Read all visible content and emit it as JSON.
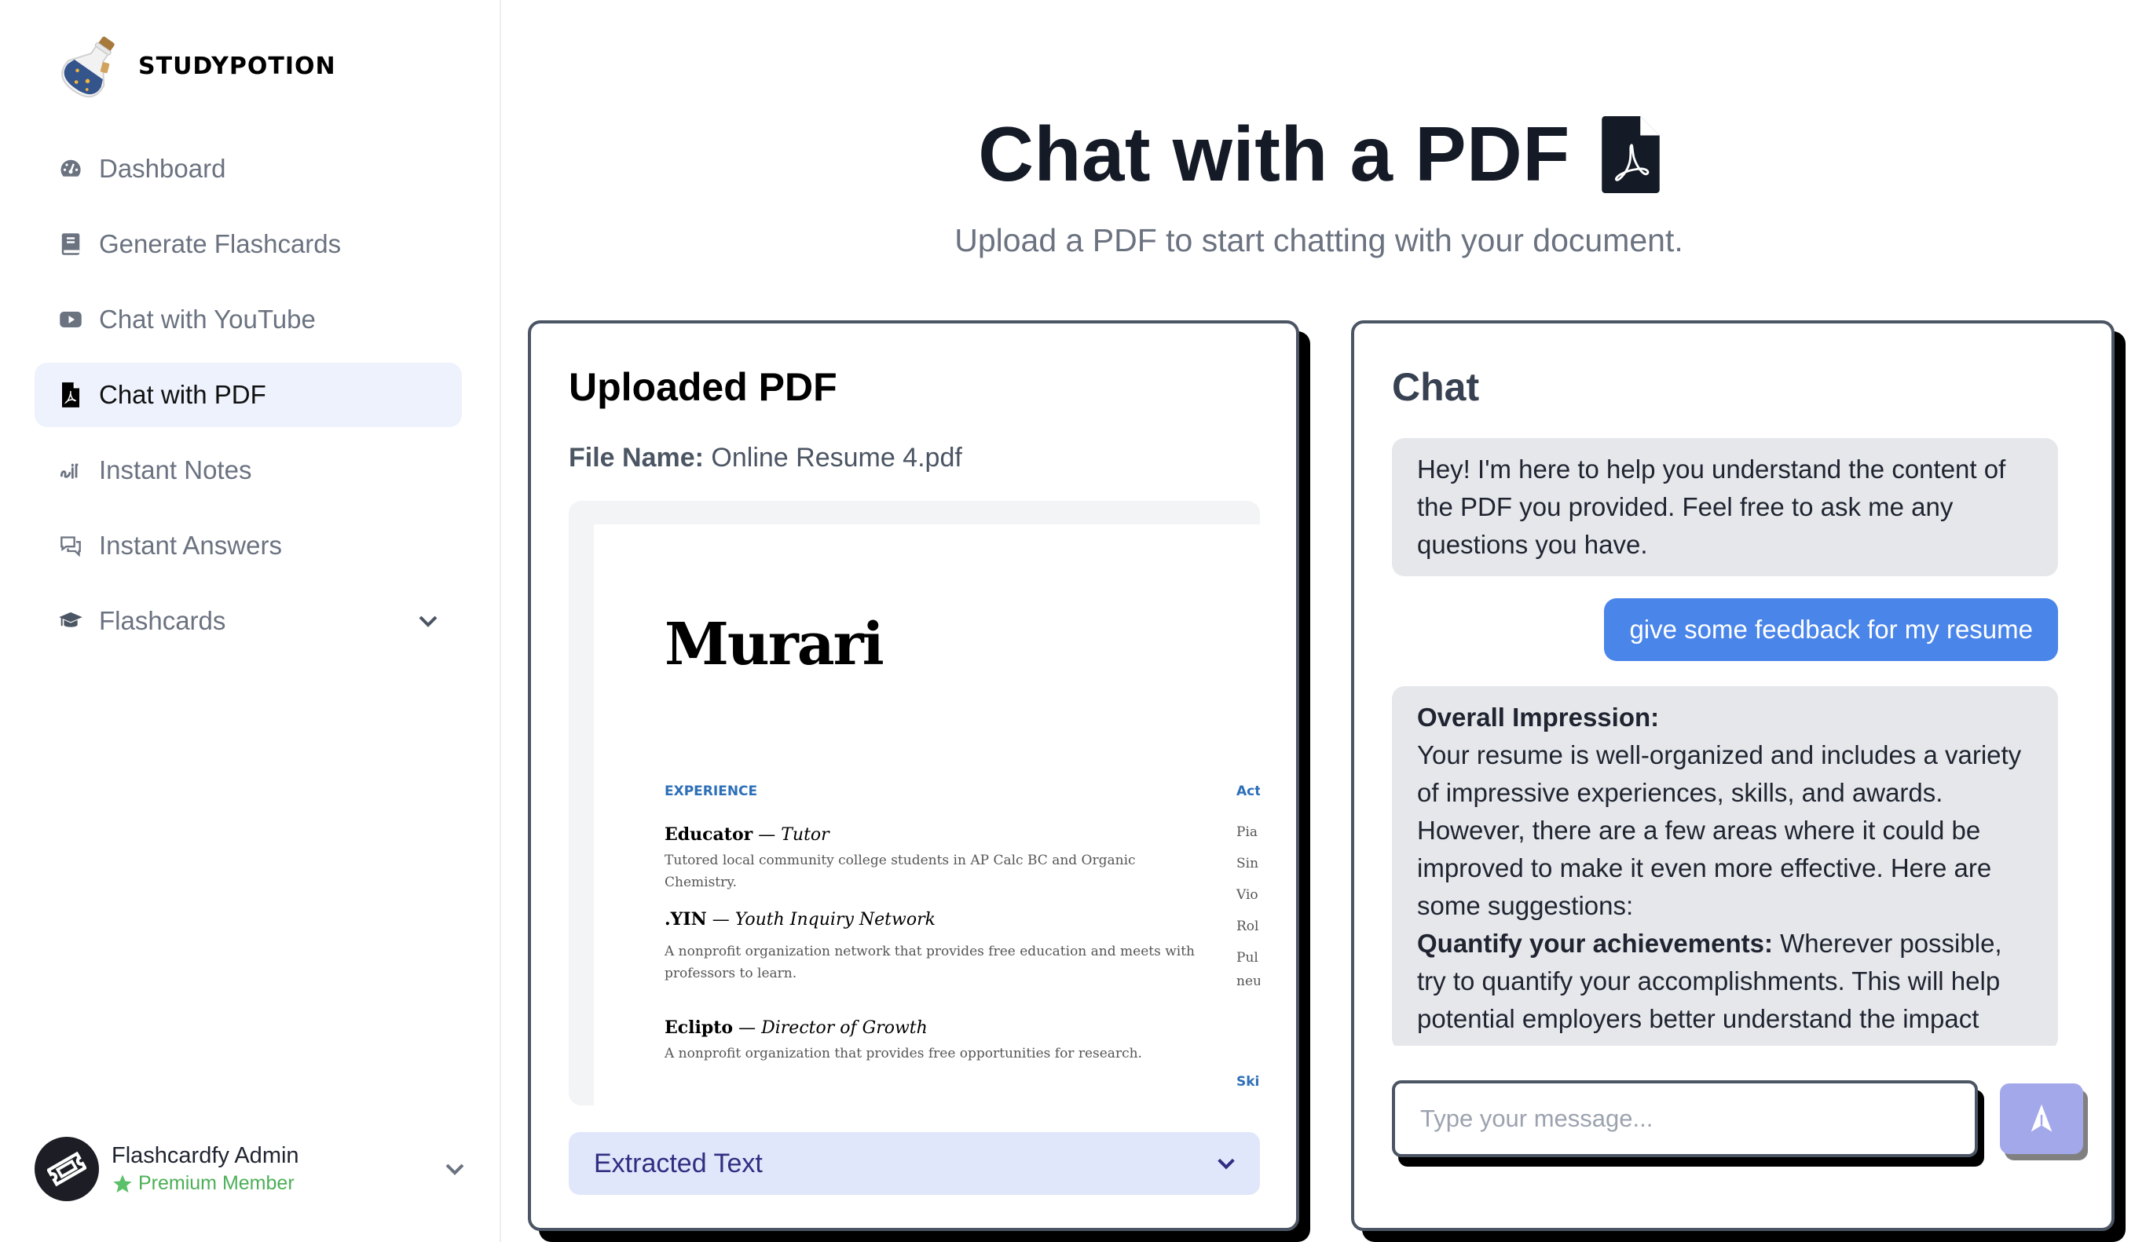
{
  "brand": {
    "name": "STUDYPOTION",
    "logo_icon": "potion-bottle-icon"
  },
  "sidebar": {
    "items": [
      {
        "label": "Dashboard",
        "icon": "gauge-icon",
        "active": false
      },
      {
        "label": "Generate Flashcards",
        "icon": "book-icon",
        "active": false
      },
      {
        "label": "Chat with YouTube",
        "icon": "youtube-icon",
        "active": false
      },
      {
        "label": "Chat with PDF",
        "icon": "file-pdf-icon",
        "active": true
      },
      {
        "label": "Instant Notes",
        "icon": "signature-icon",
        "active": false
      },
      {
        "label": "Instant Answers",
        "icon": "chat-bubbles-icon",
        "active": false
      },
      {
        "label": "Flashcards",
        "icon": "graduation-cap-icon",
        "active": false,
        "expandable": true
      }
    ]
  },
  "user": {
    "name": "Flashcardfy Admin",
    "badge": "Premium Member",
    "avatar_icon": "ticket-icon"
  },
  "header": {
    "title": "Chat with a PDF",
    "title_icon": "file-pdf-icon",
    "subtitle": "Upload a PDF to start chatting with your document."
  },
  "pdf_card": {
    "title": "Uploaded PDF",
    "file_label": "File Name:",
    "file_name": "Online Resume 4.pdf",
    "preview": {
      "name": "Murari",
      "section_experience": "EXPERIENCE",
      "section_right_partial": "Act",
      "section_skills_partial": "Ski",
      "jobs": [
        {
          "org": "Educator",
          "role": "Tutor",
          "desc": "Tutored local community college students in AP Calc BC and Organic Chemistry."
        },
        {
          "org": ".YIN",
          "role": "Youth Inquiry Network",
          "desc": "A nonprofit organization network that provides free education and meets with professors to learn."
        },
        {
          "org": "Eclipto",
          "role": "Director of Growth",
          "desc": "A nonprofit organization that provides free opportunities for research."
        }
      ],
      "right_column_partial": [
        "Pia",
        "Sin",
        "Vio",
        "Rol",
        "Pul",
        "neu"
      ]
    },
    "extracted_text_label": "Extracted Text"
  },
  "chat_card": {
    "title": "Chat",
    "messages": [
      {
        "role": "assistant",
        "text": "Hey! I'm here to help you understand the content of the PDF you provided. Feel free to ask me any questions you have."
      },
      {
        "role": "user",
        "text": "give some feedback for my resume"
      },
      {
        "role": "assistant",
        "heading": "Overall Impression:",
        "body": "Your resume is well-organized and includes a variety of impressive experiences, skills, and awards. However, there are a few areas where it could be improved to make it even more effective. Here are some suggestions:",
        "point_title": "Quantify your achievements:",
        "point_body": "Wherever possible, try to quantify your accomplishments. This will help potential employers better understand the impact"
      }
    ],
    "input_placeholder": "Type your message...",
    "input_value": "",
    "send_icon": "send-arrow-icon"
  },
  "colors": {
    "accent_blue": "#4a85ea",
    "active_nav_bg": "#eef2fd",
    "send_button": "#a3a8ea",
    "premium_green": "#4caf57",
    "extracted_bg": "#e0e7fb",
    "extracted_text": "#312e81"
  }
}
